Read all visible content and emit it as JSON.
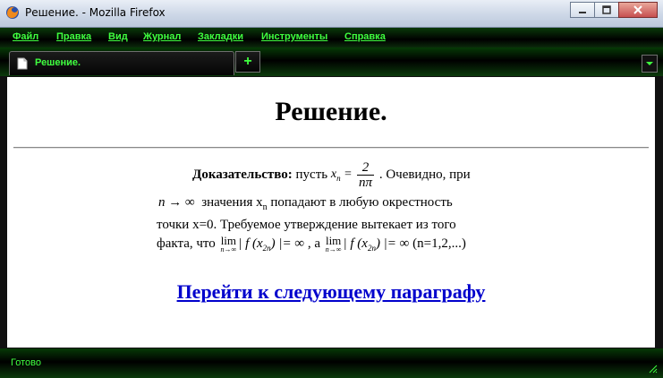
{
  "window": {
    "title": "Решение. - Mozilla Firefox"
  },
  "menubar": {
    "items": [
      "Файл",
      "Правка",
      "Вид",
      "Журнал",
      "Закладки",
      "Инструменты",
      "Справка"
    ]
  },
  "tabs": {
    "active_label": "Решение.",
    "new_tab_symbol": "+"
  },
  "content": {
    "heading": "Решение.",
    "proof_label": "Доказательство:",
    "line1_a": "пусть",
    "line1_b": ". Очевидно, при",
    "frac_lhs": "x",
    "frac_lhs_sub": "n",
    "frac_num": "2",
    "frac_den": "nπ",
    "line2_math": "n → ∞",
    "line2_text_a": "значения x",
    "line2_text_sub": "n",
    "line2_text_b": "попадают в любую окрестность",
    "line3": "точки x=0. Требуемое утверждение вытекает из того",
    "line4_a": "факта, что",
    "lim_label": "lim",
    "lim_sub": "n→∞",
    "expr1": "| f (x",
    "expr1_sub": "2n",
    "expr1_end": ") |= ∞",
    "line4_mid": ", а",
    "expr2": "| f (x",
    "expr2_sub": "2n",
    "expr2_end": ") |= ∞",
    "line4_end": "(n=1,2,...)",
    "next_link": "Перейти к следующему параграфу"
  },
  "status": {
    "text": "Готово"
  },
  "colors": {
    "accent_green": "#3fff3f",
    "link_blue": "#0000cc"
  }
}
